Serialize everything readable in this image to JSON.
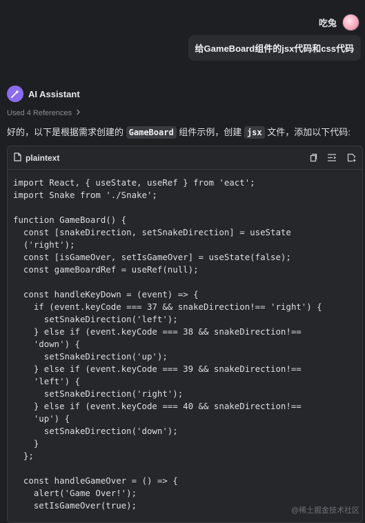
{
  "user": {
    "name": "吃兔"
  },
  "user_message": "给GameBoard组件的jsx代码和css代码",
  "assistant": {
    "name": "AI Assistant",
    "references_label": "Used 4 References",
    "intro": {
      "part1": "好的，以下是根据需求创建的",
      "code1": "GameBoard",
      "part2": "组件示例，创建",
      "code2": "jsx",
      "part3": "文件，添加以下代码:"
    }
  },
  "code_block": {
    "language": "plaintext",
    "lines": [
      "import React, { useState, useRef } from 'eact';",
      "import Snake from './Snake';",
      "",
      "function GameBoard() {",
      "  const [snakeDirection, setSnakeDirection] = useState",
      "  ('right');",
      "  const [isGameOver, setIsGameOver] = useState(false);",
      "  const gameBoardRef = useRef(null);",
      "",
      "  const handleKeyDown = (event) => {",
      "    if (event.keyCode === 37 && snakeDirection!== 'right') {",
      "      setSnakeDirection('left');",
      "    } else if (event.keyCode === 38 && snakeDirection!==",
      "    'down') {",
      "      setSnakeDirection('up');",
      "    } else if (event.keyCode === 39 && snakeDirection!==",
      "    'left') {",
      "      setSnakeDirection('right');",
      "    } else if (event.keyCode === 40 && snakeDirection!==",
      "    'up') {",
      "      setSnakeDirection('down');",
      "    }",
      "  };",
      "",
      "  const handleGameOver = () => {",
      "    alert('Game Over!');",
      "    setIsGameOver(true);"
    ]
  },
  "watermark": "@稀土掘金技术社区"
}
